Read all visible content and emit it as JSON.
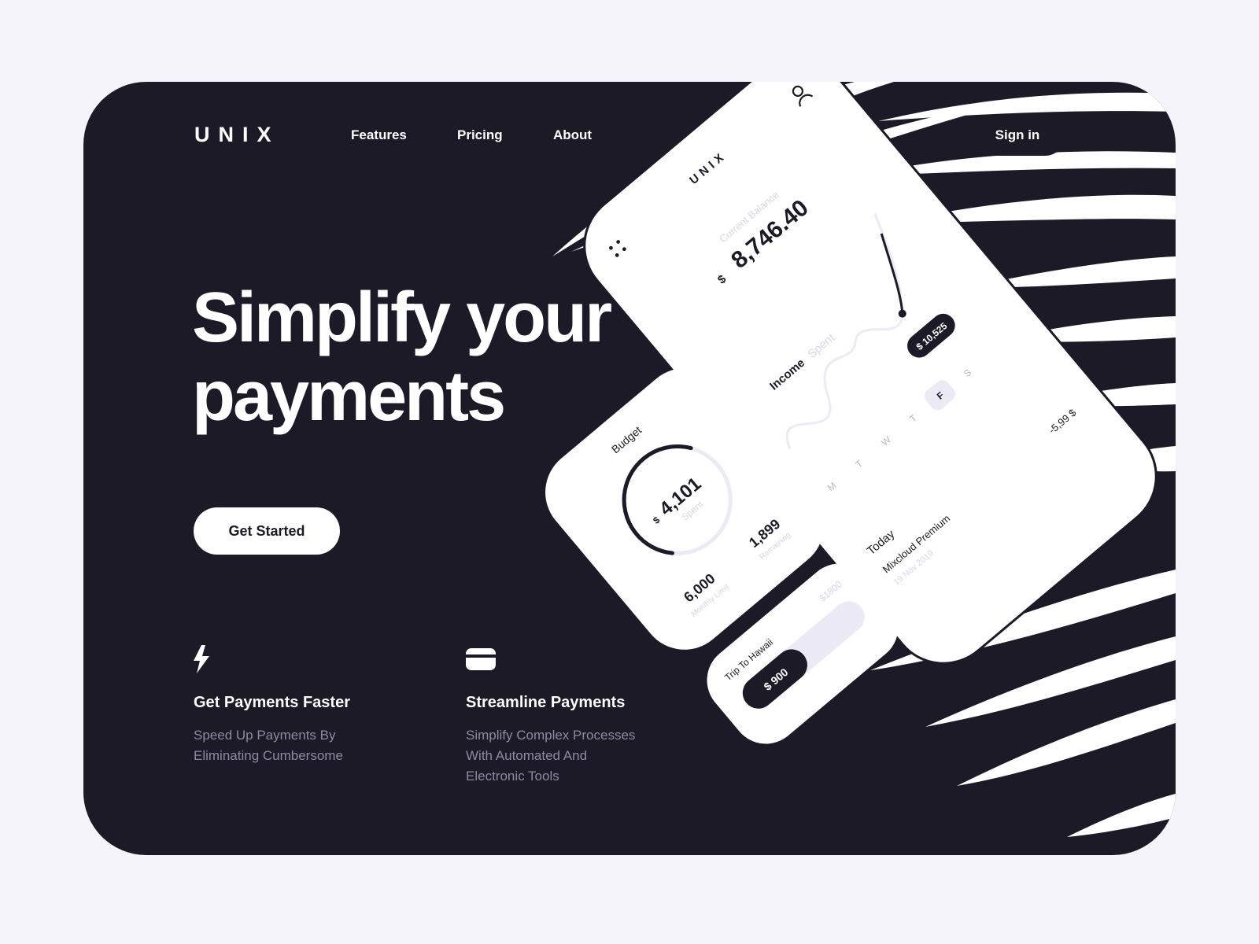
{
  "brand": "UNIX",
  "nav": {
    "features": "Features",
    "pricing": "Pricing",
    "about": "About",
    "sign_in": "Sign in"
  },
  "hero": {
    "line1": "Simplify your",
    "line2": "payments",
    "cta": "Get Started"
  },
  "features": [
    {
      "icon": "lightning-icon",
      "title": "Get Payments Faster",
      "desc_line1": "Speed Up Payments By",
      "desc_line2": "Eliminating Cumbersome"
    },
    {
      "icon": "credit-card-icon",
      "title": "Streamline Payments",
      "desc_line1": "Simplify Complex Processes",
      "desc_line2": "With Automated And",
      "desc_line3": "Electronic Tools"
    }
  ],
  "phone": {
    "brand": "UNIX",
    "balance_label": "Current Balance",
    "currency": "$",
    "balance": "8,746.40",
    "tab_income": "Income",
    "tab_spent": "Spent",
    "chart_badge": "$ 10,525",
    "days": [
      "M",
      "T",
      "W",
      "T",
      "F",
      "S"
    ],
    "today_label": "Today",
    "transaction_name": "Mixcloud Premium",
    "transaction_date": "19 Nov 2019",
    "transaction_amount": "-5,99 $"
  },
  "budget": {
    "title": "Budget",
    "spent_value": "4,101",
    "spent_label": "Spent",
    "remaining_value": "1,899",
    "remaining_label": "Remaining",
    "limit_value": "6,000",
    "limit_label": "Monthly Limit",
    "currency": "$",
    "spent_fraction": 0.68
  },
  "trip": {
    "title": "Trip To Hawaii",
    "goal": "$1800",
    "saved": "$ 900",
    "progress": 0.5
  },
  "colors": {
    "background": "#f4f4fa",
    "card": "#1b1a26",
    "white": "#ffffff",
    "muted": "#8d8ba3",
    "accent_light": "#ecebf5"
  }
}
